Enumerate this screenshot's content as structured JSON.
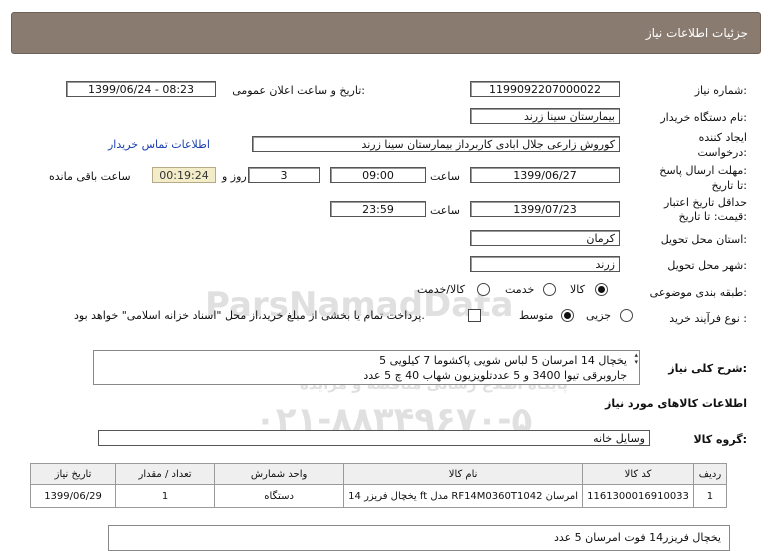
{
  "header": {
    "title": "جزئیات اطلاعات نیاز"
  },
  "form": {
    "need_number_label": "شماره نیاز:",
    "need_number": "1199092207000022",
    "announce_label": "تاریخ و ساعت اعلان عمومی:",
    "announce_value": "1399/06/24 - 08:23",
    "buyer_org_label": "نام دستگاه خریدار:",
    "buyer_org": "بیمارستان سینا زرند",
    "creator_label_1": "ایجاد کننده",
    "creator_label_2": "درخواست:",
    "creator": "کوروش زارعی جلال ابادی  کاربرداز بیمارستان سینا زرند",
    "contact_link": "اطلاعات تماس خریدار",
    "reply_deadline_label_1": "مهلت ارسال پاسخ:",
    "reply_deadline_label_2": "تا تاریخ:",
    "reply_date": "1399/06/27",
    "time_label": "ساعت",
    "reply_time": "09:00",
    "days": "3",
    "days_label": "روز و",
    "remaining_time": "00:19:24",
    "remaining_label": "ساعت باقی مانده",
    "price_validity_label_1": "حداقل تاریخ اعتبار",
    "price_validity_label_2": "قیمت: تا تاریخ:",
    "price_date": "1399/07/23",
    "price_time_label": "ساعت",
    "price_time": "23:59",
    "province_label": "استان محل تحویل:",
    "province": "کرمان",
    "city_label": "شهر محل تحویل:",
    "city": "زرند",
    "category_label": "طبقه بندی موضوعی:",
    "category_options": [
      "کالا",
      "خدمت",
      "کالا/خدمت"
    ],
    "process_label": "نوع فرآیند خرید :",
    "process_options": [
      "جزیی",
      "متوسط"
    ],
    "payment_note": "پرداخت تمام یا بخشی از مبلغ خرید،از محل \"اسناد خزانه اسلامی\" خواهد بود."
  },
  "description": {
    "label": "شرح کلی نیاز:",
    "line1": "یخچال 14 امرسان 5  لباس شویی پاکشوما 7 کیلویی 5",
    "line2": "جاروبرقی تیوا 3400 و 5 عددتلویزیون شهاب 40 چ 5 عدد"
  },
  "goods_info_title": "اطلاعات کالاهای مورد نیاز",
  "goods_group": {
    "label": "گروه کالا:",
    "value": "وسایل خانه"
  },
  "table": {
    "headers": [
      "ردیف",
      "کد کالا",
      "نام کالا",
      "واحد شمارش",
      "تعداد / مقدار",
      "تاریخ نیاز"
    ],
    "rows": [
      [
        "1",
        "1161300016910033",
        "یخچال فریزر 14 ft مدل RF14M0360T1042 امرسان",
        "دستگاه",
        "1",
        "1399/06/29"
      ]
    ]
  },
  "bottom_note": "یخچال فریزر14 فوت امرسان 5 عدد",
  "watermark": {
    "line1": "ParsNamadData",
    "line2": "پایگاه اطلاع رسانی مناقصه و مزایده",
    "line3": "۰۲۱-۸۸۳۴۹۶۷۰-۵"
  }
}
